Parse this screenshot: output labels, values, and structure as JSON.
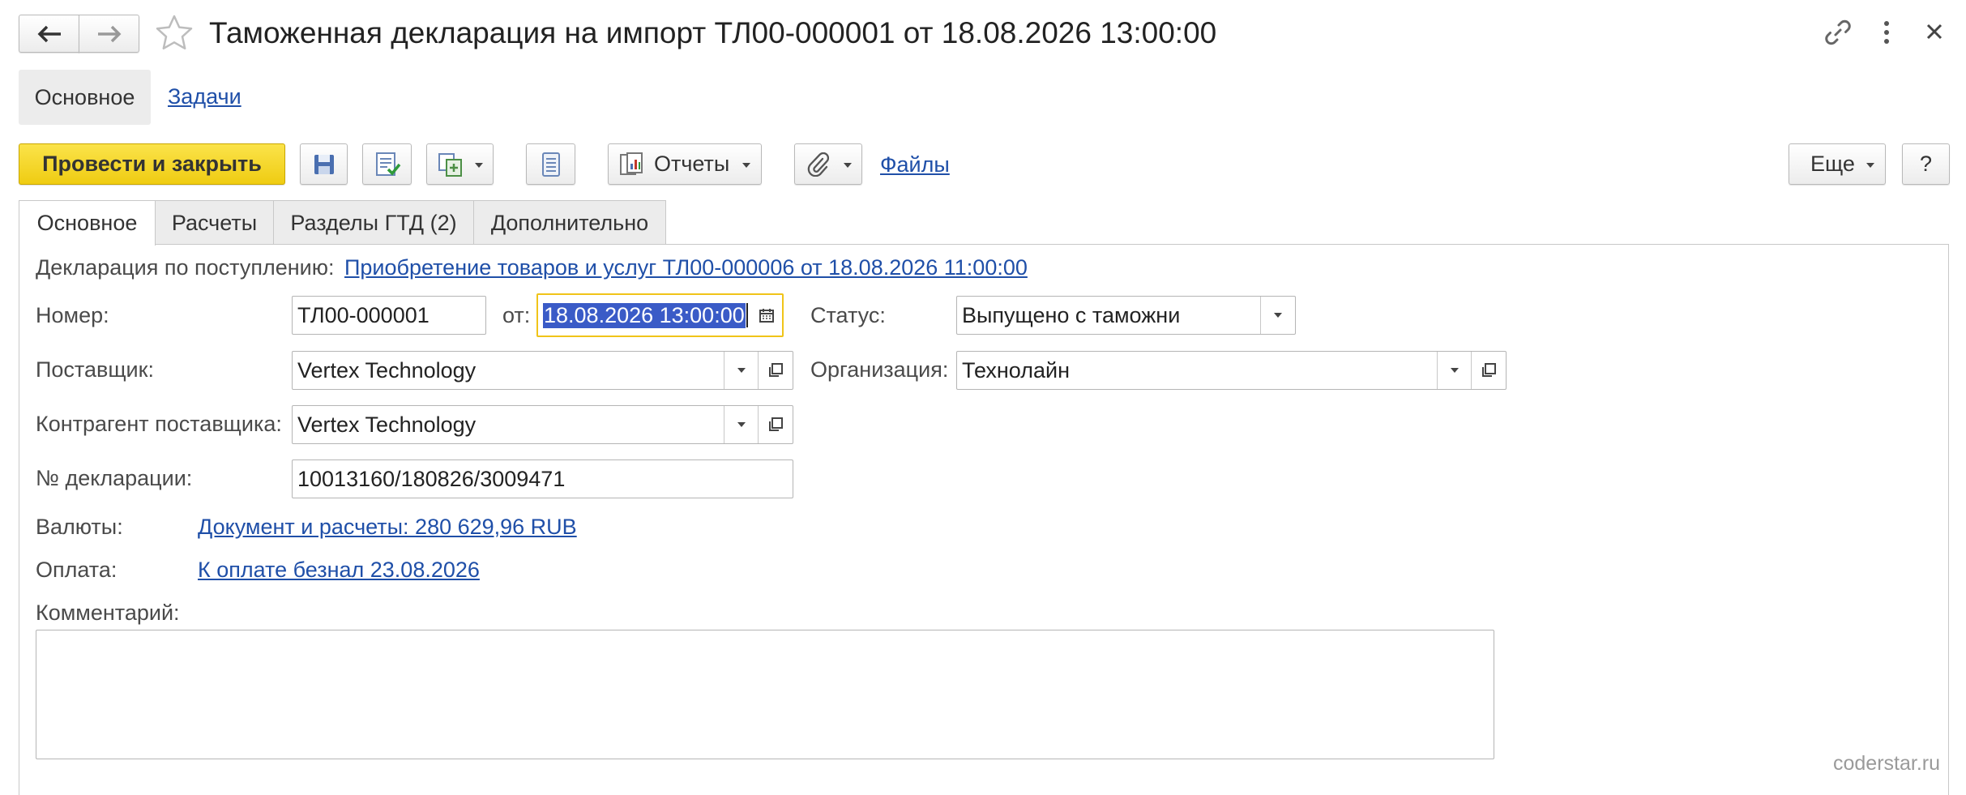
{
  "window": {
    "title": "Таможенная декларация на импорт ТЛ00-000001 от 18.08.2026 13:00:00"
  },
  "nav": {
    "sections": [
      {
        "label": "Основное",
        "active": true
      },
      {
        "label": "Задачи",
        "active": false
      }
    ]
  },
  "toolbar": {
    "post_close_label": "Провести и закрыть",
    "reports_label": "Отчеты",
    "files_label": "Файлы",
    "more_label": "Еще",
    "help_label": "?"
  },
  "tabs": [
    {
      "label": "Основное",
      "active": true
    },
    {
      "label": "Расчеты",
      "active": false
    },
    {
      "label": "Разделы ГТД (2)",
      "active": false
    },
    {
      "label": "Дополнительно",
      "active": false
    }
  ],
  "form": {
    "basis_label": "Декларация по поступлению:",
    "basis_link": "Приобретение товаров и услуг ТЛ00-000006 от 18.08.2026 11:00:00",
    "number_label": "Номер:",
    "number_value": "ТЛ00-000001",
    "date_label": "от:",
    "date_value": "18.08.2026 13:00:00",
    "status_label": "Статус:",
    "status_value": "Выпущено с таможни",
    "supplier_label": "Поставщик:",
    "supplier_value": "Vertex Technology",
    "org_label": "Организация:",
    "org_value": "Технолайн",
    "counterparty_label": "Контрагент поставщика:",
    "counterparty_value": "Vertex Technology",
    "decl_no_label": "№ декларации:",
    "decl_no_value": "10013160/180826/3009471",
    "currency_label": "Валюты:",
    "currency_link": "Документ и расчеты: 280 629,96 RUB",
    "payment_label": "Оплата:",
    "payment_link": "К оплате безнал 23.08.2026",
    "comment_label": "Комментарий:",
    "comment_value": ""
  },
  "watermark": "coderstar.ru",
  "colors": {
    "primary_button": "#f5d426",
    "link": "#1f4fa8",
    "selection": "#3a5bc7",
    "focus_border": "#f0c419"
  },
  "icons": [
    "arrow-left-icon",
    "arrow-right-icon",
    "star-icon",
    "link-icon",
    "more-vertical-icon",
    "close-icon",
    "save-icon",
    "post-icon",
    "create-based-on-icon",
    "structure-icon",
    "reports-icon",
    "paperclip-icon",
    "calendar-icon",
    "open-form-icon",
    "chevron-down-icon"
  ]
}
